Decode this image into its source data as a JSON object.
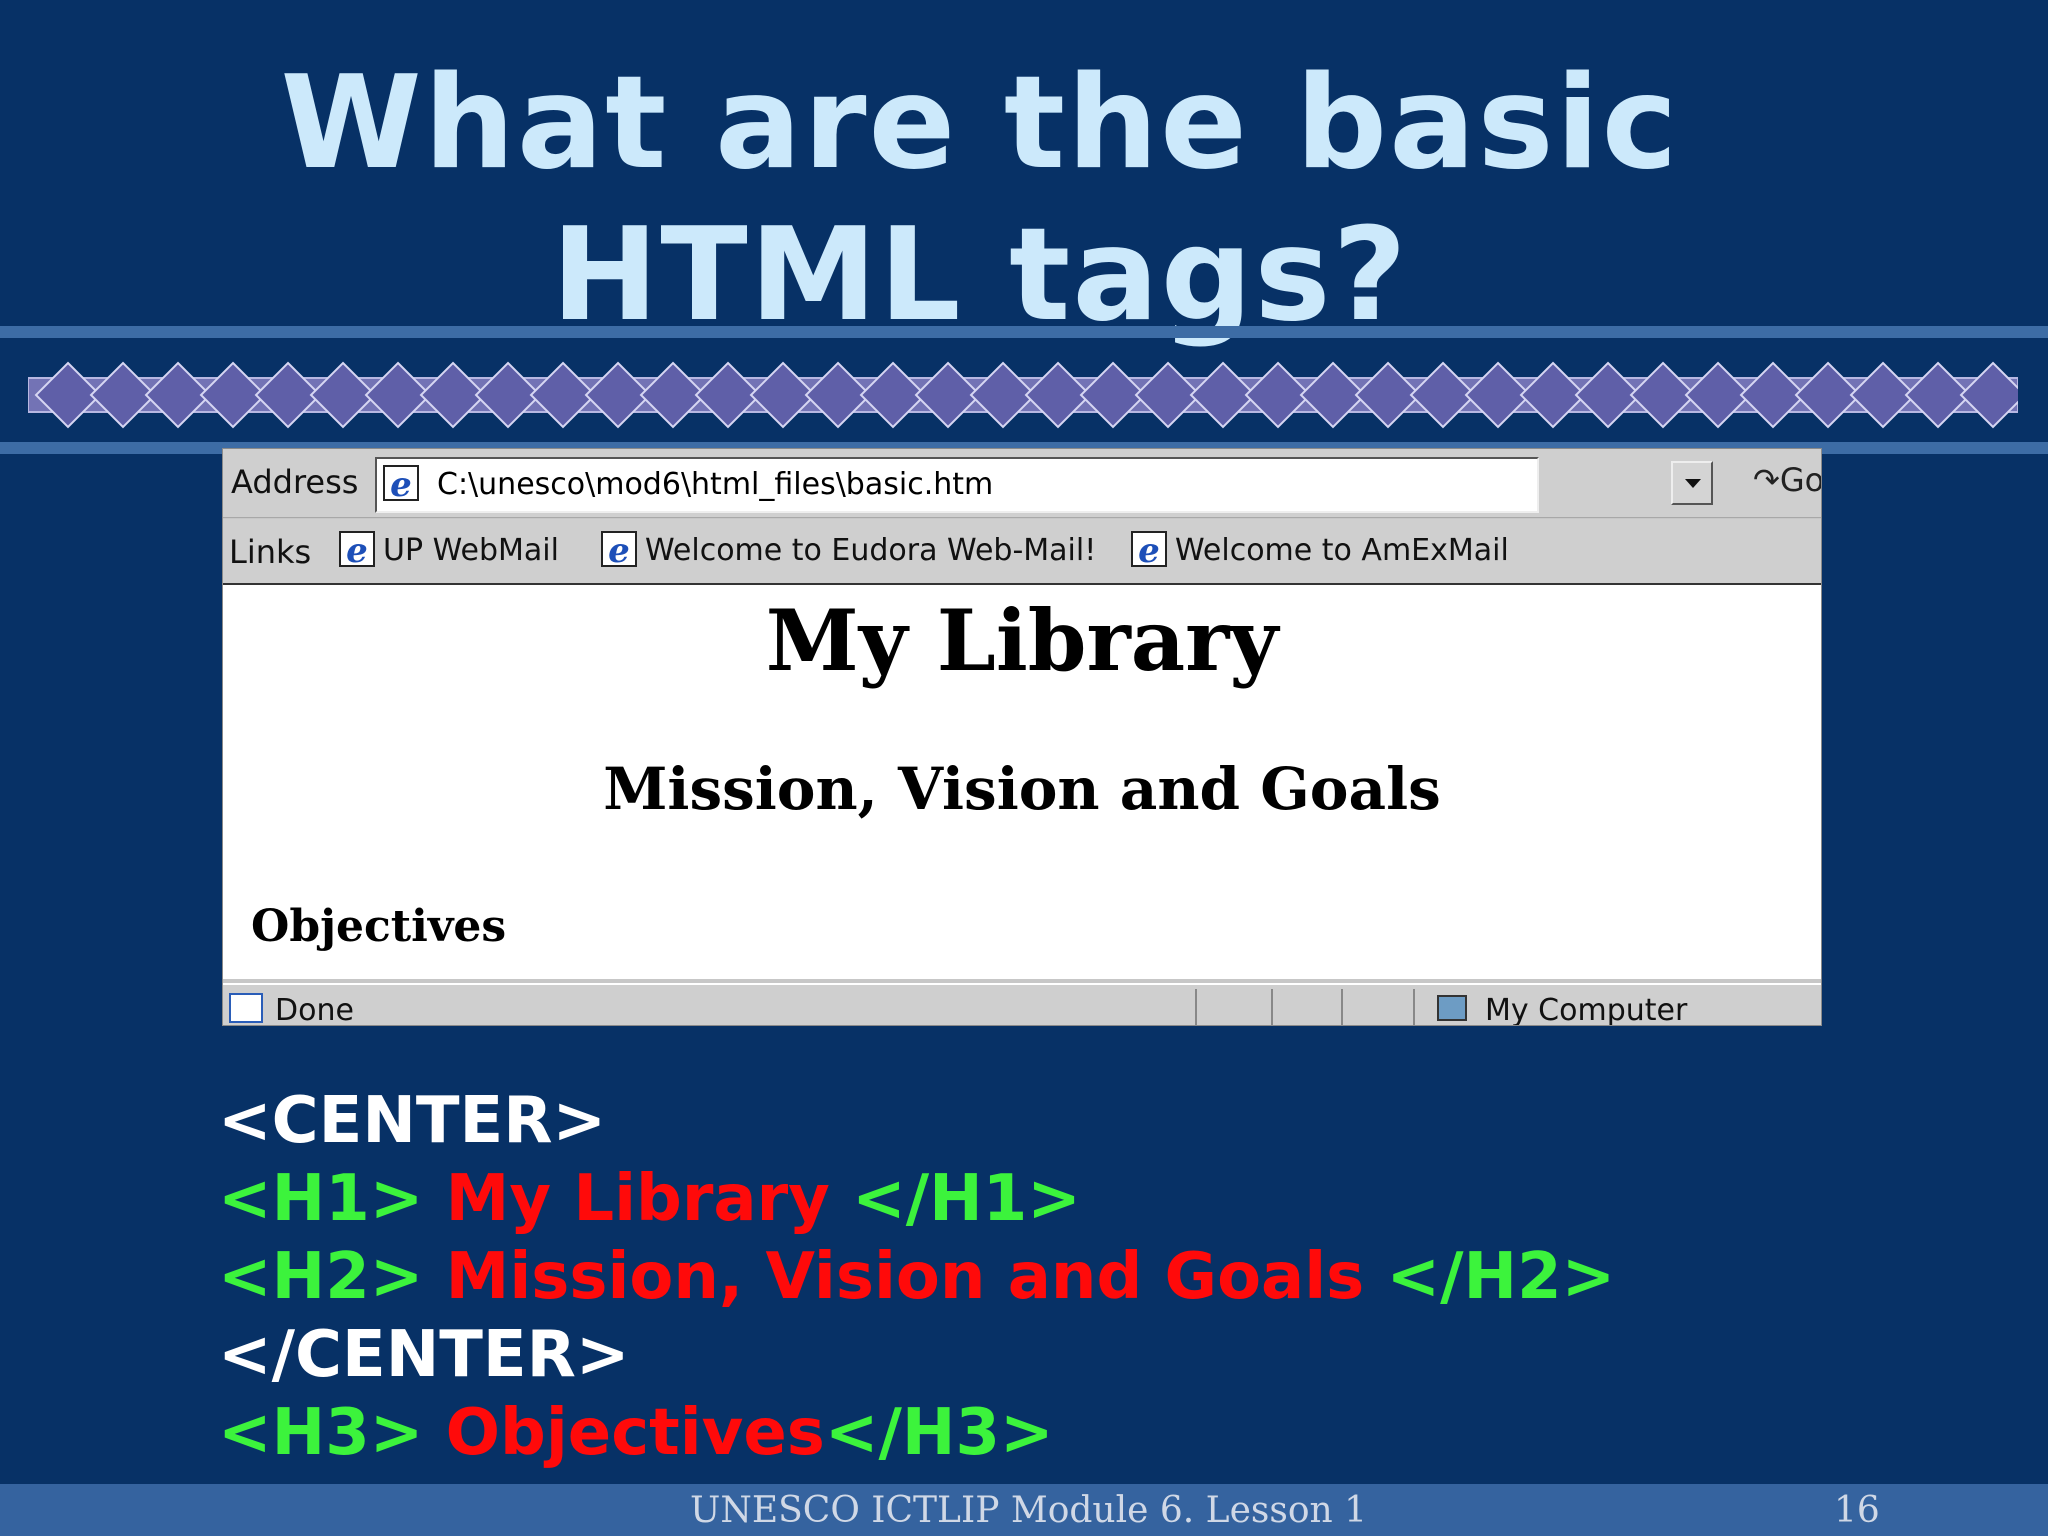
{
  "slide": {
    "title_line1": "What are the basic",
    "title_line2": "HTML tags?"
  },
  "browser": {
    "address_label": "Address",
    "address_value": "C:\\unesco\\mod6\\html_files\\basic.htm",
    "go_label": "Go",
    "links_label": "Links",
    "links": [
      "UP WebMail",
      "Welcome to Eudora Web-Mail!",
      "Welcome to AmExMail"
    ],
    "page": {
      "h1": "My Library",
      "h2": "Mission, Vision and Goals",
      "h3": "Objectives"
    },
    "status_text": "Done",
    "status_zone": "My Computer"
  },
  "code": {
    "center_open": "<CENTER>",
    "h1_open": "<H1> ",
    "h1_text": "My Library",
    "h1_close": " </H1>",
    "h2_open": "<H2> ",
    "h2_text": "Mission, Vision and Goals",
    "h2_close": " </H2>",
    "center_close": "</CENTER>",
    "h3_open": "<H3> ",
    "h3_text": "Objectives",
    "h3_close": "</H3>"
  },
  "footer": {
    "text": "UNESCO ICTLIP Module 6.  Lesson 1",
    "page_number": "16"
  },
  "colors": {
    "background": "#073166",
    "title": "#cce9fb",
    "tag_green": "#3cf33c",
    "content_red": "#ff0a0a",
    "band": "#3d6ca5"
  },
  "icons": [
    "ie-page-icon",
    "dropdown-arrow-icon",
    "go-arrow-icon",
    "status-page-icon",
    "computer-icon"
  ]
}
